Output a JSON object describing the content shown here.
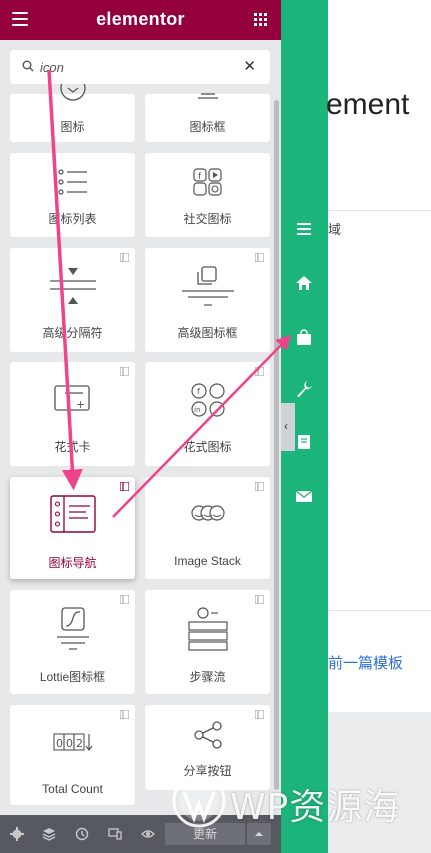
{
  "header": {
    "brand": "elementor",
    "menu_icon": "hamburger-icon",
    "grid_icon": "apps-grid-icon"
  },
  "search": {
    "value": "icon",
    "clear_label": "✕"
  },
  "widgets": [
    {
      "label": "图标",
      "icon": "icon-widget-icon",
      "pro": false
    },
    {
      "label": "图标框",
      "icon": "icon-box-icon",
      "pro": false
    },
    {
      "label": "图标列表",
      "icon": "icon-list-icon",
      "pro": false
    },
    {
      "label": "社交图标",
      "icon": "social-icons-icon",
      "pro": false
    },
    {
      "label": "高级分隔符",
      "icon": "advanced-divider-icon",
      "pro": true
    },
    {
      "label": "高级图标框",
      "icon": "advanced-icon-box-icon",
      "pro": true
    },
    {
      "label": "花式卡",
      "icon": "flip-card-icon",
      "pro": true
    },
    {
      "label": "花式图标",
      "icon": "fancy-social-icon",
      "pro": true
    },
    {
      "label": "图标导航",
      "icon": "icon-nav-icon",
      "pro": true,
      "active": true
    },
    {
      "label": "Image Stack",
      "icon": "image-stack-icon",
      "pro": true
    },
    {
      "label": "Lottie图标框",
      "icon": "lottie-icon-box-icon",
      "pro": true
    },
    {
      "label": "步骤流",
      "icon": "step-flow-icon",
      "pro": true
    },
    {
      "label": "Total Count",
      "icon": "total-count-icon",
      "pro": true
    },
    {
      "label": "分享按钮",
      "icon": "share-icon",
      "pro": true
    }
  ],
  "footer": {
    "update_label": "更新"
  },
  "sidebar": [
    "menu-icon",
    "home-icon",
    "bag-icon",
    "wrench-icon",
    "book-icon",
    "mail-icon"
  ],
  "preview": {
    "title": "ement",
    "small_text": "域",
    "link_text": "前一篇模板"
  },
  "watermark": {
    "text": "WP资源海"
  },
  "colors": {
    "brand": "#93003c",
    "sidebar_green": "#1bb47b",
    "arrow_pink": "#f0448a",
    "link_blue": "#2f6fd8"
  }
}
